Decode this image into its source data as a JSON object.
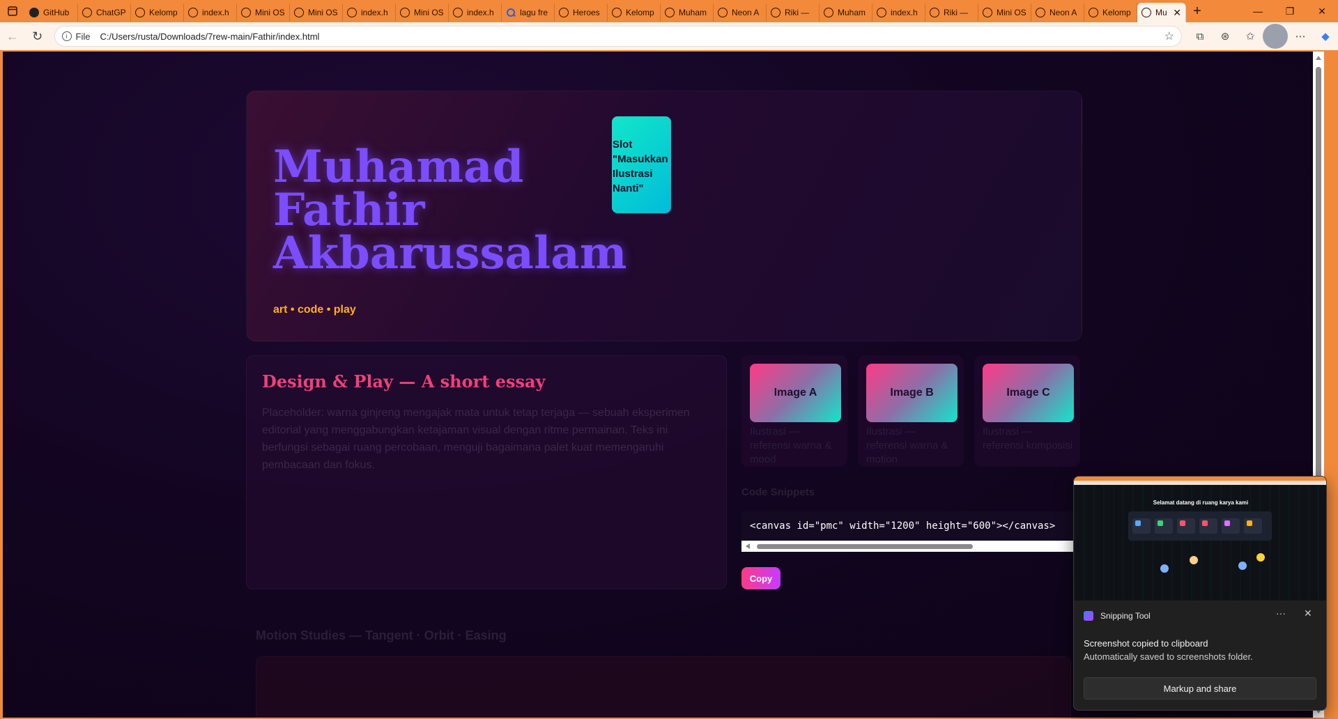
{
  "browser": {
    "tabs": [
      {
        "label": "GitHub",
        "icon": "github-icon"
      },
      {
        "label": "ChatGPT",
        "icon": "chatgpt-icon"
      },
      {
        "label": "Kelomp",
        "icon": "globe-icon"
      },
      {
        "label": "index.h",
        "icon": "globe-icon"
      },
      {
        "label": "Mini OS",
        "icon": "globe-icon"
      },
      {
        "label": "Mini OS",
        "icon": "globe-icon"
      },
      {
        "label": "index.h",
        "icon": "globe-icon"
      },
      {
        "label": "Mini OS",
        "icon": "globe-icon"
      },
      {
        "label": "index.h",
        "icon": "globe-icon"
      },
      {
        "label": "lagu fre",
        "icon": "search-icon"
      },
      {
        "label": "Heroes",
        "icon": "globe-icon"
      },
      {
        "label": "Kelomp",
        "icon": "globe-icon"
      },
      {
        "label": "Muham",
        "icon": "globe-icon"
      },
      {
        "label": "Neon A",
        "icon": "globe-icon"
      },
      {
        "label": "Riki —",
        "icon": "globe-icon"
      },
      {
        "label": "Muham",
        "icon": "globe-icon"
      },
      {
        "label": "index.h",
        "icon": "globe-icon"
      },
      {
        "label": "Riki —",
        "icon": "globe-icon"
      },
      {
        "label": "Mini OS",
        "icon": "globe-icon"
      },
      {
        "label": "Neon A",
        "icon": "globe-icon"
      },
      {
        "label": "Kelomp",
        "icon": "globe-icon"
      }
    ],
    "active_tab": {
      "label": "Mu",
      "close": "✕"
    },
    "new_tab": "+",
    "window_controls": {
      "minimize": "—",
      "maximize": "❐",
      "close": "✕"
    },
    "address": {
      "scheme": "File",
      "url": "C:/Users/rusta/Downloads/7rew-main/Fathir/index.html"
    }
  },
  "hero": {
    "title": "Muhamad Fathir Akbarussalam",
    "tagline": "art • code • play",
    "slot_text": "Slot \"Masukkan Ilustrasi Nanti\""
  },
  "essay": {
    "title": "Design & Play — A short essay",
    "body": "Placeholder: warna ginjreng mengajak mata untuk tetap terjaga — sebuah eksperimen editorial yang menggabungkan ketajaman visual dengan ritme permainan. Teks ini berfungsi sebagai ruang percobaan, menguji bagaimana palet kuat memengaruhi pembacaan dan fokus."
  },
  "gallery": [
    {
      "label": "Image A",
      "caption": "Ilustrasi — referensi warna & mood"
    },
    {
      "label": "Image B",
      "caption": "Ilustrasi — referensi warna & motion"
    },
    {
      "label": "Image C",
      "caption": "Ilustrasi — referensi komposisi"
    }
  ],
  "snippets": {
    "label": "Code Snippets",
    "code": "<canvas id=\"pmc\" width=\"1200\" height=\"600\"></canvas>",
    "copy_label": "Copy"
  },
  "motion": {
    "title": "Motion Studies — Tangent · Orbit · Easing"
  },
  "toast": {
    "app": "Snipping Tool",
    "more": "···",
    "close": "✕",
    "message": "Screenshot copied to clipboard",
    "sub": "Automatically saved to screenshots folder.",
    "button": "Markup and share",
    "preview_title": "Selamat datang di ruang karya kami"
  },
  "colors": {
    "accent_purple": "#7b4dff",
    "accent_pink": "#f0407a",
    "accent_gold": "#ffb020",
    "accent_teal": "#12e6c9",
    "browser_orange": "#f3893a"
  }
}
